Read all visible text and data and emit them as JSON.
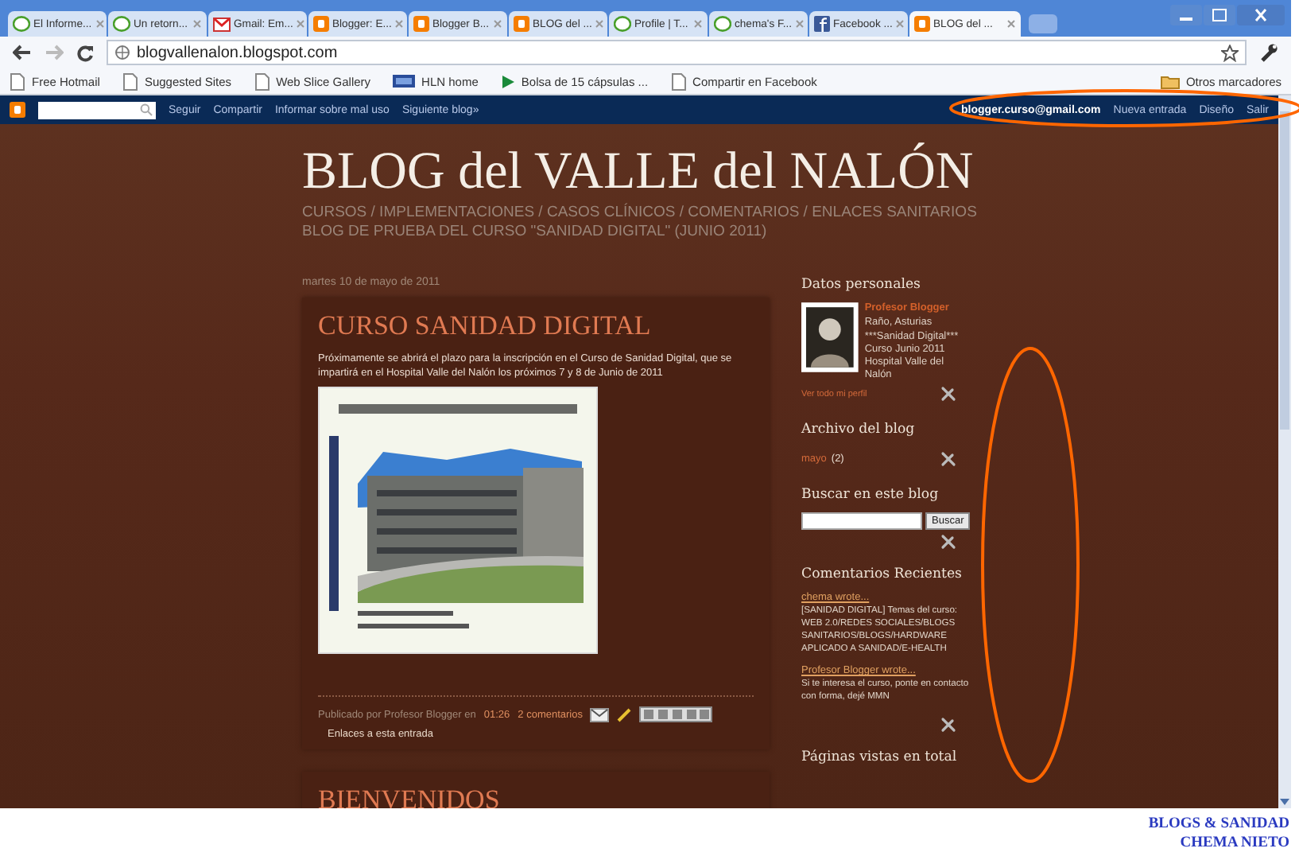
{
  "browser": {
    "tabs": [
      {
        "label": "El Informe...",
        "kind": "page",
        "selected": false
      },
      {
        "label": "Un retorn...",
        "kind": "page",
        "selected": false
      },
      {
        "label": "Gmail: Em...",
        "kind": "mail",
        "selected": false
      },
      {
        "label": "Blogger: E...",
        "kind": "blogger",
        "selected": false
      },
      {
        "label": "Blogger B...",
        "kind": "blogger",
        "selected": false
      },
      {
        "label": "BLOG del ...",
        "kind": "blogger",
        "selected": false
      },
      {
        "label": "Profile | T...",
        "kind": "page",
        "selected": false
      },
      {
        "label": "chema's F...",
        "kind": "page",
        "selected": false
      },
      {
        "label": "Facebook ...",
        "kind": "facebook",
        "selected": false
      },
      {
        "label": "BLOG del ...",
        "kind": "blogger",
        "selected": true
      }
    ],
    "address": "blogvallenalon.blogspot.com",
    "bookmarks": [
      {
        "label": "Free Hotmail",
        "kind": "page"
      },
      {
        "label": "Suggested Sites",
        "kind": "page"
      },
      {
        "label": "Web Slice Gallery",
        "kind": "page"
      },
      {
        "label": "HLN home",
        "kind": "hln"
      },
      {
        "label": "Bolsa de 15 cápsulas ...",
        "kind": "play"
      },
      {
        "label": "Compartir en Facebook",
        "kind": "page"
      }
    ],
    "other_bookmarks": "Otros marcadores"
  },
  "navbar": {
    "links": [
      "Seguir",
      "Compartir",
      "Informar sobre mal uso",
      "Siguiente blog»"
    ],
    "account": "blogger.curso@gmail.com",
    "actions": [
      "Nueva entrada",
      "Diseño",
      "Salir"
    ]
  },
  "blog": {
    "title": "BLOG del VALLE del NALÓN",
    "description": [
      "CURSOS / IMPLEMENTACIONES / CASOS CLÍNICOS / COMENTARIOS / ENLACES SANITARIOS",
      "BLOG DE PRUEBA DEL CURSO \"SANIDAD DIGITAL\" (JUNIO 2011)"
    ]
  },
  "post": {
    "date": "martes 10 de mayo de 2011",
    "title": "CURSO SANIDAD DIGITAL",
    "body": "Próximamente se abrirá el plazo para la inscripción en el Curso de Sanidad Digital, que se impartirá en el Hospital Valle del Nalón los próximos 7 y 8 de Junio de 2011",
    "author": "Publicado por Profesor Blogger en",
    "time": "01:26",
    "comments": "2 comentarios",
    "backlinks": "Enlaces a esta entrada"
  },
  "next_post": {
    "title": "BIENVENIDOS"
  },
  "sidebar": {
    "profile": {
      "heading": "Datos personales",
      "name": "Profesor Blogger",
      "location": "Raño, Asturias",
      "about": [
        "***Sanidad Digital***",
        "Curso Junio 2011",
        "Hospital Valle del Nalón"
      ],
      "link": "Ver todo mi perfil"
    },
    "archive": {
      "heading": "Archivo del blog",
      "items": [
        {
          "label": "mayo",
          "count": "(2)"
        }
      ]
    },
    "search": {
      "heading": "Buscar en este blog",
      "button": "Buscar"
    },
    "comments": {
      "heading": "Comentarios Recientes",
      "items": [
        {
          "author": "chema wrote...",
          "text": "[SANIDAD DIGITAL] Temas del curso: WEB 2.0/REDES SOCIALES/BLOGS SANITARIOS/BLOGS/HARDWARE APLICADO A SANIDAD/E-HEALTH"
        },
        {
          "author": "Profesor Blogger wrote...",
          "text": "Si te interesa el curso, ponte en contacto con forma, dejé MMN"
        }
      ]
    },
    "pageviews": {
      "heading": "Páginas vistas en total"
    }
  },
  "caption": [
    "BLOGS & SANIDAD",
    "CHEMA NIETO"
  ]
}
